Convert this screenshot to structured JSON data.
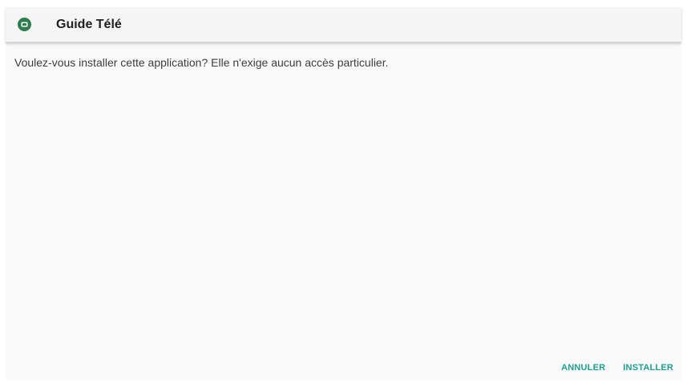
{
  "header": {
    "icon": "tv-guide-app-icon",
    "title": "Guide Télé"
  },
  "dialog": {
    "message": "Voulez-vous installer cette application? Elle n'exige aucun accès particulier."
  },
  "actions": {
    "cancel_label": "ANNULER",
    "install_label": "INSTALLER"
  },
  "colors": {
    "accent": "#1e9e8e",
    "icon_bg": "#2e7d4f",
    "header_bg": "#f5f5f5",
    "body_bg": "#fafafa"
  }
}
